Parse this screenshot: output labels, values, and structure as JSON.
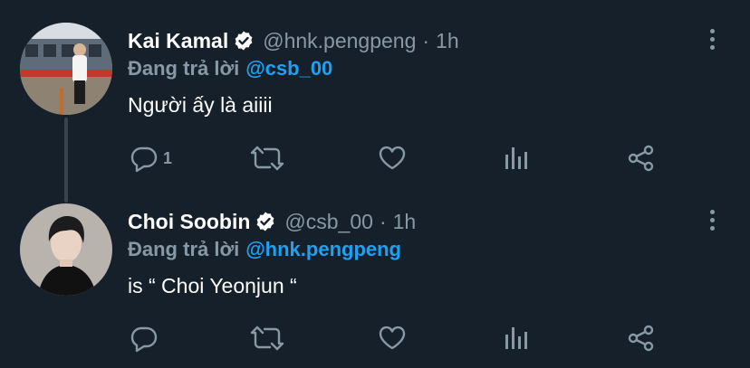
{
  "theme": {
    "background": "#15202b",
    "text_primary": "#ffffff",
    "text_secondary": "#8899a6",
    "accent": "#1da1f2",
    "thread_line": "#38444d"
  },
  "tweets": [
    {
      "display_name": "Kai Kamal",
      "verified": true,
      "handle": "@hnk.pengpeng",
      "separator": "·",
      "time": "1h",
      "reply_label": "Đang trả lời",
      "reply_to": "@csb_00",
      "text": "Người ấy là aiiii",
      "reply_count": "1",
      "icons": [
        "reply-icon",
        "retweet-icon",
        "like-icon",
        "analytics-icon",
        "share-icon",
        "more-icon"
      ]
    },
    {
      "display_name": "Choi Soobin",
      "verified": true,
      "handle": "@csb_00",
      "separator": "·",
      "time": "1h",
      "reply_label": "Đang trả lời",
      "reply_to": "@hnk.pengpeng",
      "text": "is “ Choi Yeonjun “",
      "reply_count": "",
      "icons": [
        "reply-icon",
        "retweet-icon",
        "like-icon",
        "analytics-icon",
        "share-icon",
        "more-icon"
      ]
    }
  ]
}
